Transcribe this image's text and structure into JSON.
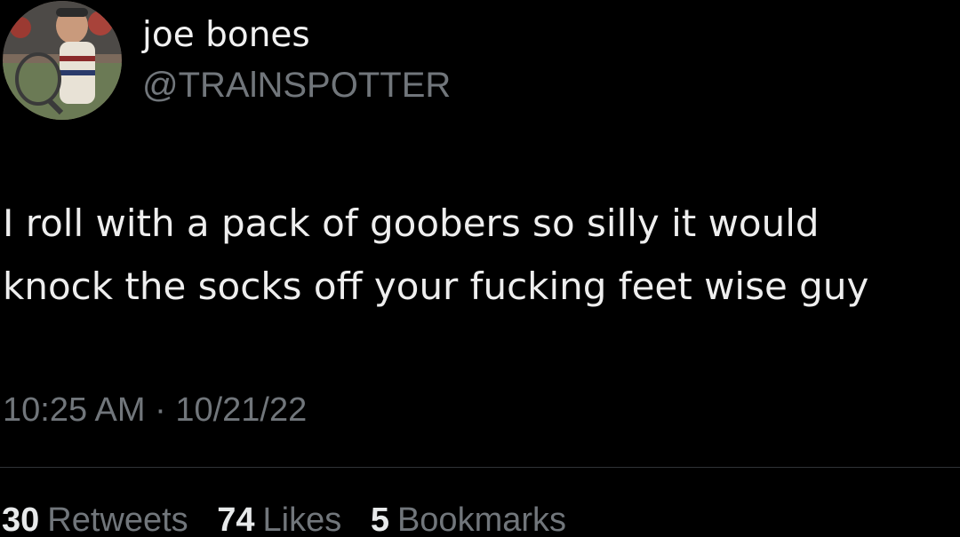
{
  "author": {
    "display_name": "joe bones",
    "handle": "@TRAlNSPOTTER",
    "avatar_icon": "avatar-photo"
  },
  "tweet": {
    "lines": [
      "I roll with a pack of goobers so silly it would",
      "knock the socks off your fucking feet wise guy"
    ],
    "timestamp": "10:25 AM · 10/21/22"
  },
  "stats": {
    "retweets_count": "30",
    "retweets_label": "Retweets",
    "likes_count": "74",
    "likes_label": "Likes",
    "bookmarks_count": "5",
    "bookmarks_label": "Bookmarks"
  },
  "colors": {
    "background": "#000000",
    "primary_text": "#e7e9ea",
    "secondary_text": "#71767b",
    "divider": "#2f3336"
  }
}
